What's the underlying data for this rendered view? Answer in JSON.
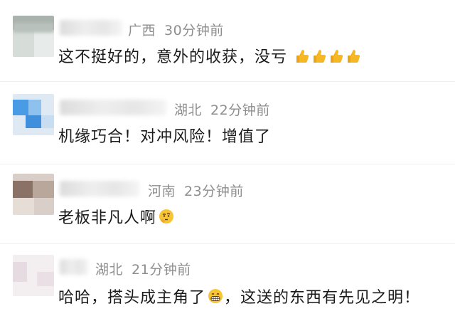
{
  "comments": [
    {
      "location": "广西",
      "time": "30分钟前",
      "text": "这不挺好的，意外的收获，没亏",
      "trailing_emojis": [
        "thumbs-up",
        "thumbs-up",
        "thumbs-up",
        "thumbs-up"
      ]
    },
    {
      "location": "湖北",
      "time": "22分钟前",
      "text": "机缘巧合！对冲风险！增值了"
    },
    {
      "location": "河南",
      "time": "23分钟前",
      "text": "老板非凡人啊",
      "trailing_emojis": [
        "thinking-face"
      ]
    },
    {
      "location": "湖北",
      "time": "21分钟前",
      "text_before": "哈哈，搭头成主角了",
      "inline_emoji": "grinning-face",
      "text_after": "，这送的东西有先见之明！"
    }
  ],
  "colors": {
    "meta_text": "#8e8e8e",
    "body_text": "#1a1a1a",
    "background": "#ffffff",
    "thumbs_up": "#f5b724"
  }
}
